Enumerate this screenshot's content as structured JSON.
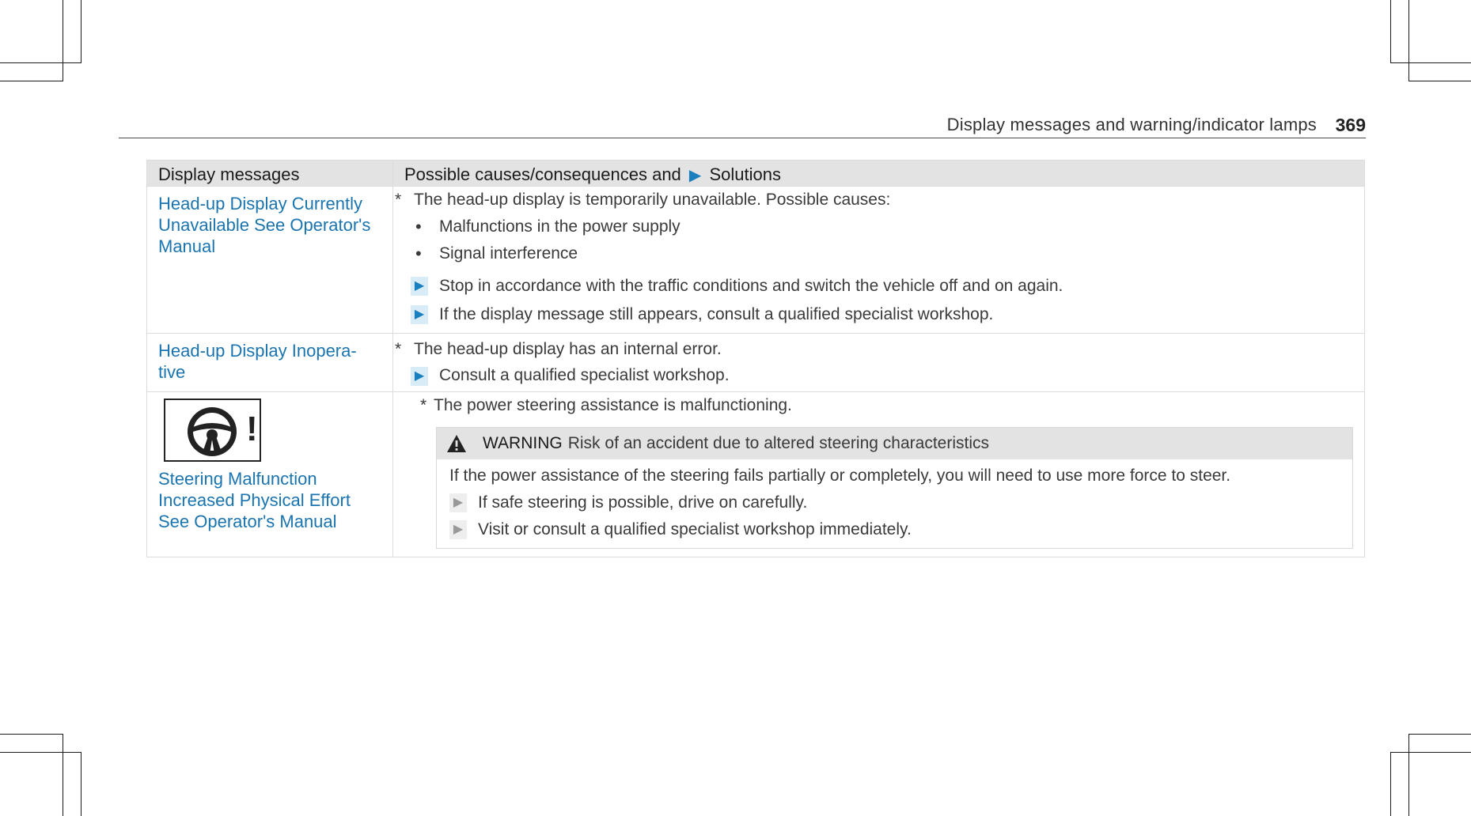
{
  "header": {
    "title": "Display messages and warning/indicator lamps",
    "page_number": "369"
  },
  "table": {
    "col1_header": "Display messages",
    "col2_header_pre": "Possible causes/consequences and",
    "col2_header_arrow": "▶",
    "col2_header_post": "Solutions",
    "rows": [
      {
        "message": "Head-up Display Currently Unavailable See Operator's Manual",
        "cause_marker": "*",
        "cause": "The head-up display is temporarily unavailable. Possible causes:",
        "bullets": [
          "Malfunctions in the power supply",
          "Signal interference"
        ],
        "steps": [
          "Stop in accordance with the traffic conditions and switch the vehicle off and on again.",
          "If the display message still appears, consult a qualified specialist workshop."
        ]
      },
      {
        "message": "Head-up Display Inopera-tive",
        "cause_marker": "*",
        "cause": "The head-up display has an internal error.",
        "steps": [
          "Consult a qualified specialist workshop."
        ]
      },
      {
        "icon": "steering-wheel-warning-icon",
        "icon_symbol": "!",
        "message": "Steering Malfunction Increased Physical Effort See Operator's Manual",
        "cause_marker": "*",
        "cause": "The power steering assistance is malfunctioning.",
        "warning": {
          "icon": "warning-triangle-icon",
          "label": "WARNING",
          "title": "Risk of an accident due to altered steering characteristics",
          "text": "If the power assistance of the steering fails partially or completely, you will need to use more force to steer.",
          "steps": [
            "If safe steering is possible, drive on carefully.",
            "Visit or consult a qualified specialist workshop immediately."
          ]
        }
      }
    ]
  },
  "colors": {
    "message_blue": "#1a74b0",
    "header_gray": "#e3e3e3",
    "step_arrow_blue": "#1a7fbf"
  }
}
